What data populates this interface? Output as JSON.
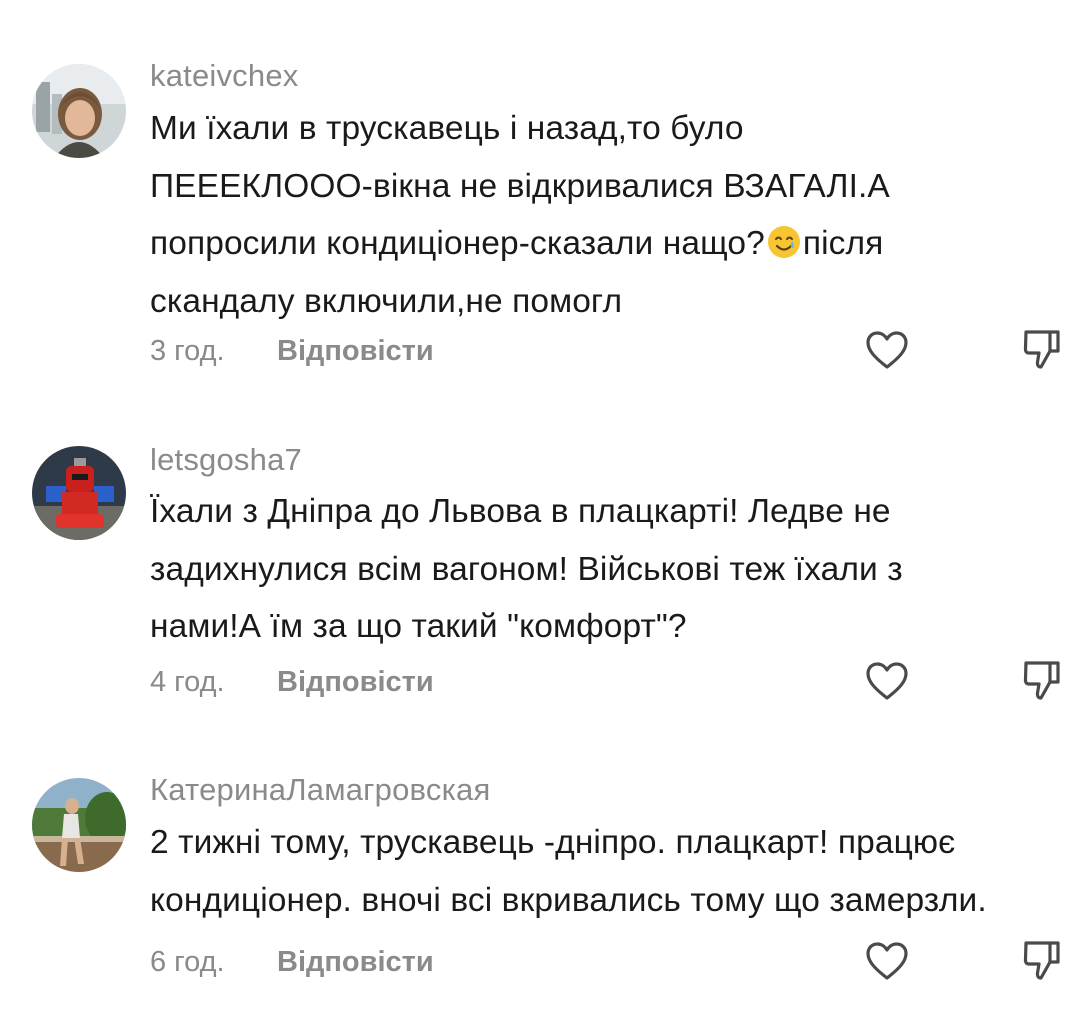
{
  "comments": [
    {
      "username": "kateivchex",
      "lines": [
        "Ми їхали в трускавець і назад,то було",
        "ПЕЕЕКЛООО-вікна не відкривалися ВЗАГАЛІ.А",
        "попросили кондиціонер-сказали нащо?",
        "скандалу включили,не помогл"
      ],
      "line3_after_emoji": "після",
      "emoji": "smiling-face-with-tear-icon",
      "time": "3 год.",
      "reply_label": "Відповісти"
    },
    {
      "username": "letsgosha7",
      "lines": [
        "Їхали з Дніпра до Львова в плацкарті! Ледве не",
        "задихнулися всім вагоном! Військові теж їхали з",
        "нами!А їм за що такий \"комфорт\"?"
      ],
      "time": "4 год.",
      "reply_label": "Відповісти"
    },
    {
      "username": "КатеринаЛамагровская",
      "lines": [
        "2 тижні тому, трускавець -дніпро. плацкарт! працює",
        "кондиціонер. вночі всі вкривались тому що замерзли."
      ],
      "time": "6 год.",
      "reply_label": "Відповісти"
    }
  ],
  "colors": {
    "text": "#1a1a1a",
    "muted": "#8a8a8a",
    "icon": "#4a4a4a"
  }
}
